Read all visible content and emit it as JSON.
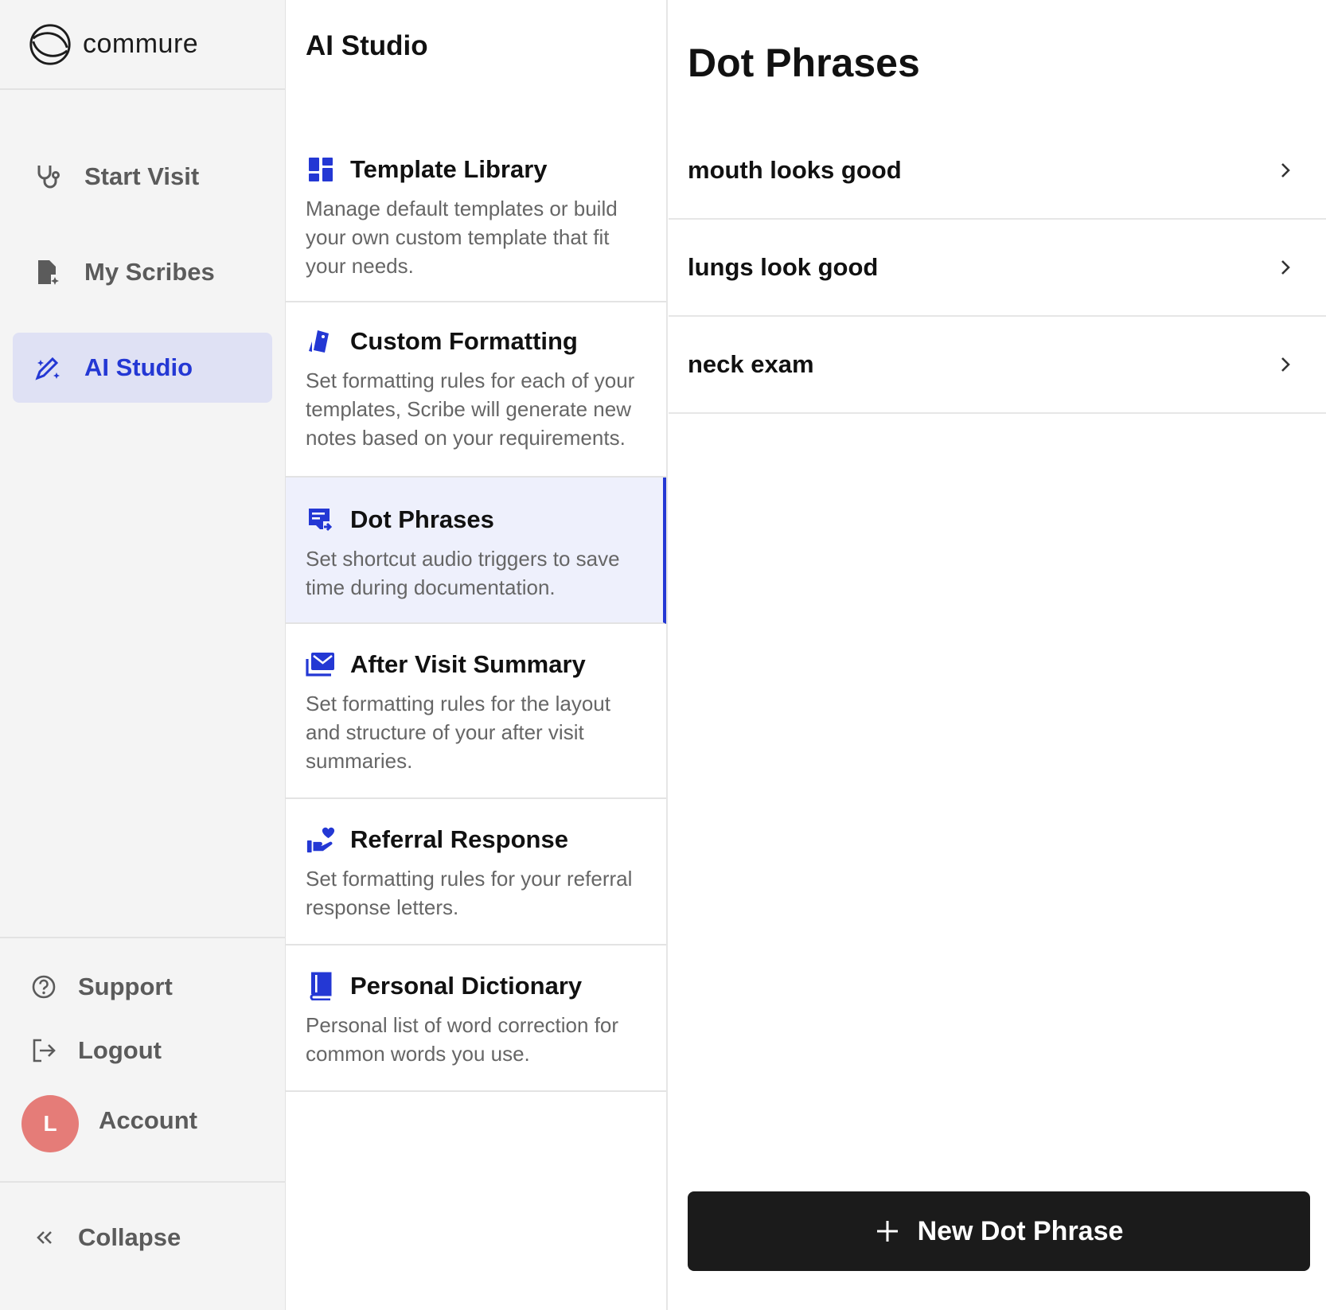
{
  "brand": {
    "name": "commure"
  },
  "sidebar": {
    "items": [
      {
        "label": "Start Visit",
        "icon": "stethoscope-icon"
      },
      {
        "label": "My Scribes",
        "icon": "document-sparkle-icon"
      },
      {
        "label": "AI Studio",
        "icon": "magic-pencil-icon",
        "active": true
      }
    ],
    "footer": {
      "support": "Support",
      "logout": "Logout",
      "account": "Account",
      "avatar_initial": "L",
      "collapse": "Collapse"
    }
  },
  "studio": {
    "title": "AI Studio",
    "sections": [
      {
        "title": "Template Library",
        "description": "Manage default templates or build your own custom template that fit your needs.",
        "icon": "dashboard-grid-icon"
      },
      {
        "title": "Custom Formatting",
        "description": "Set formatting rules for each of your templates, Scribe will generate new notes based on your requirements.",
        "icon": "tag-icon"
      },
      {
        "title": "Dot Phrases",
        "description": "Set shortcut audio triggers to save time during documentation.",
        "icon": "note-arrow-icon",
        "active": true
      },
      {
        "title": "After Visit Summary",
        "description": "Set formatting rules for the layout and structure of your after visit summaries.",
        "icon": "mail-icon"
      },
      {
        "title": "Referral Response",
        "description": "Set formatting rules for your referral response letters.",
        "icon": "hand-heart-icon"
      },
      {
        "title": "Personal Dictionary",
        "description": "Personal list of word correction for common words you use.",
        "icon": "book-icon"
      }
    ]
  },
  "detail": {
    "title": "Dot Phrases",
    "phrases": [
      "mouth looks good",
      "lungs look good",
      "neck exam"
    ],
    "new_button": "New Dot Phrase"
  },
  "colors": {
    "accent": "#2438d4",
    "active_nav_bg": "#dfe1f4",
    "active_card_bg": "#eef0fc",
    "sidebar_bg": "#f4f4f4",
    "avatar": "#e57c78",
    "button_bg": "#1b1b1b"
  }
}
